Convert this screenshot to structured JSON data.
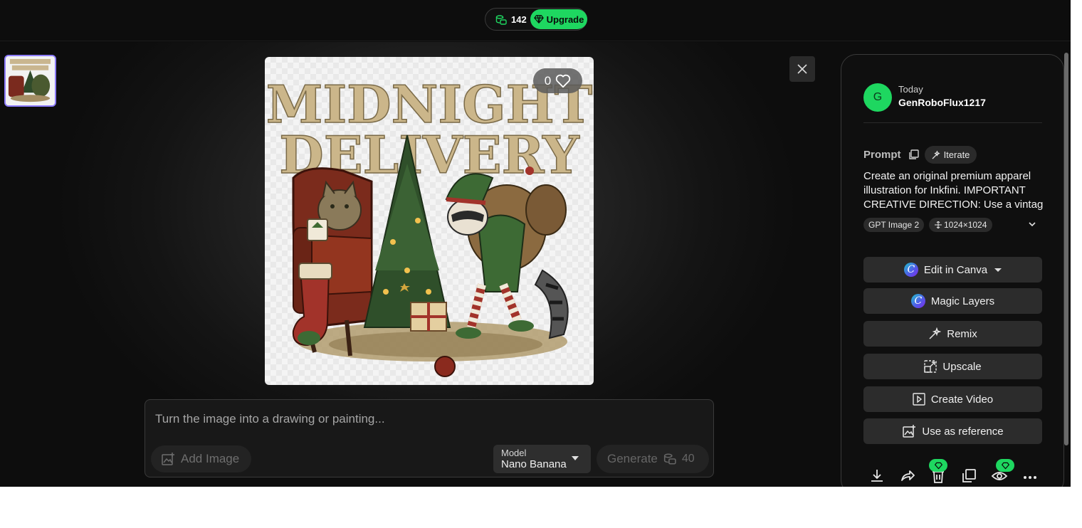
{
  "header": {
    "credits": "142",
    "upgrade_label": "Upgrade",
    "colors": {
      "accent": "#1ed760",
      "background": "#0d0d0d"
    }
  },
  "viewer": {
    "thumbnail_icon": "image-thumbnail",
    "image_text": {
      "line1": "MIDNIGHT",
      "line2": "DELIVERY"
    },
    "likes": "0",
    "close_icon": "close-icon"
  },
  "prompt_bar": {
    "placeholder": "Turn the image into a drawing or painting...",
    "add_image_label": "Add Image",
    "model_label": "Model",
    "model_value": "Nano Banana",
    "generate_label": "Generate",
    "generate_cost": "40"
  },
  "panel": {
    "avatar_initial": "G",
    "date": "Today",
    "username": "GenRoboFlux1217",
    "prompt_heading": "Prompt",
    "iterate_label": "Iterate",
    "prompt_lines": [
      "Create an original premium apparel",
      "illustration for Inkfini. IMPORTANT",
      "CREATIVE DIRECTION: Use a vintag..."
    ],
    "model_tag": "GPT Image 2",
    "size_tag": "1024×1024",
    "actions": [
      {
        "label": "Edit in Canva",
        "icon": "canva-logo"
      },
      {
        "label": "Magic Layers",
        "icon": "canva-logo"
      },
      {
        "label": "Remix",
        "icon": "magic-wand-icon"
      },
      {
        "label": "Upscale",
        "icon": "upscale-icon"
      },
      {
        "label": "Create Video",
        "icon": "video-icon"
      },
      {
        "label": "Use as reference",
        "icon": "image-add-icon"
      }
    ],
    "bottom_icons": [
      "download-icon",
      "share-icon",
      "delete-icon",
      "copy-icon",
      "eye-icon",
      "more-icon"
    ]
  }
}
